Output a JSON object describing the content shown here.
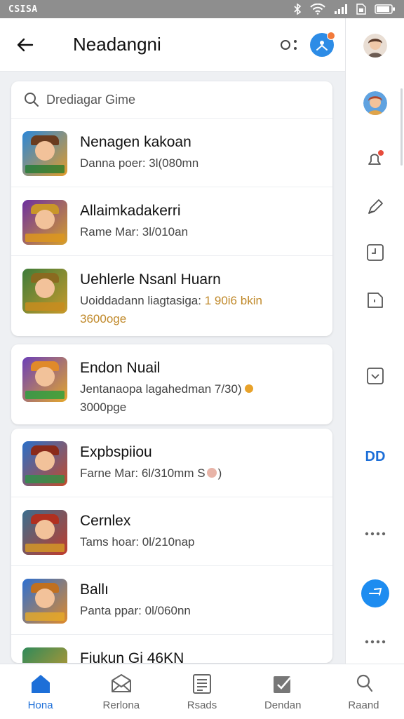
{
  "status": {
    "left_text": "CSISA"
  },
  "header": {
    "title": "Neadangni"
  },
  "search": {
    "text": "Drediagar Gime"
  },
  "games": [
    {
      "title": "Nenagen kakoan",
      "subtitle": "Danna poer: 3l(080mn",
      "accent": "",
      "extra": "",
      "colors": [
        "#2b87d8",
        "#e39b2a"
      ]
    },
    {
      "title": "Allaimkadakerri",
      "subtitle": "Rame Mar: 3l/010an",
      "accent": "",
      "extra": "",
      "colors": [
        "#6c2fa0",
        "#d7a02b"
      ]
    },
    {
      "title": "Uehlerle Nsanl Huarn",
      "subtitle": "Uoiddadann liagtasiga:",
      "accent": " 1 90i6 bkin",
      "extra": "3600oge",
      "colors": [
        "#3d7c3a",
        "#c99a2b"
      ]
    },
    {
      "title": "Endon Nuail",
      "subtitle": "Jentanaopa lagahedman 7/30)",
      "accent": "",
      "extra": "3000pge",
      "colors": [
        "#6b3fb8",
        "#e5a82b"
      ]
    },
    {
      "title": "Expbspiiou",
      "subtitle": "Farne Mar: 6l/310mm  S",
      "accent": "",
      "extra": "",
      "colors": [
        "#2a6fc9",
        "#c44a2a"
      ]
    },
    {
      "title": "Cernlex",
      "subtitle": "Tams hoar: 0l/210nap",
      "accent": "",
      "extra": "",
      "colors": [
        "#3a6e8f",
        "#c03c2c"
      ]
    },
    {
      "title": "Ballı",
      "subtitle": "Panta ppar: 0l/060nn",
      "accent": "",
      "extra": "",
      "colors": [
        "#2c6fd2",
        "#e08a2a"
      ]
    },
    {
      "title": "Fiukun Gi 46KN",
      "subtitle": "",
      "accent": "",
      "extra": "",
      "colors": [
        "#2f8a5a",
        "#d49a2b"
      ]
    }
  ],
  "bottom_nav": [
    {
      "label": "Hona",
      "icon": "home-icon",
      "active": true
    },
    {
      "label": "Rerlona",
      "icon": "mail-icon",
      "active": false
    },
    {
      "label": "Rsads",
      "icon": "document-icon",
      "active": false
    },
    {
      "label": "Dendan",
      "icon": "check-box-icon",
      "active": false
    },
    {
      "label": "Raand",
      "icon": "profile-icon",
      "active": false
    }
  ],
  "right_rail": {
    "text_item": "DD",
    "icons": [
      "avatar",
      "avatar",
      "bell-icon",
      "pen-icon",
      "clock-icon",
      "note-icon",
      "crop-icon",
      "more-icon",
      "send-icon",
      "more-icon"
    ]
  },
  "colors": {
    "accent": "#1d6fd8",
    "badge": "#f27a3a",
    "gold": "#c0892a",
    "notification": "#e74c3c"
  }
}
